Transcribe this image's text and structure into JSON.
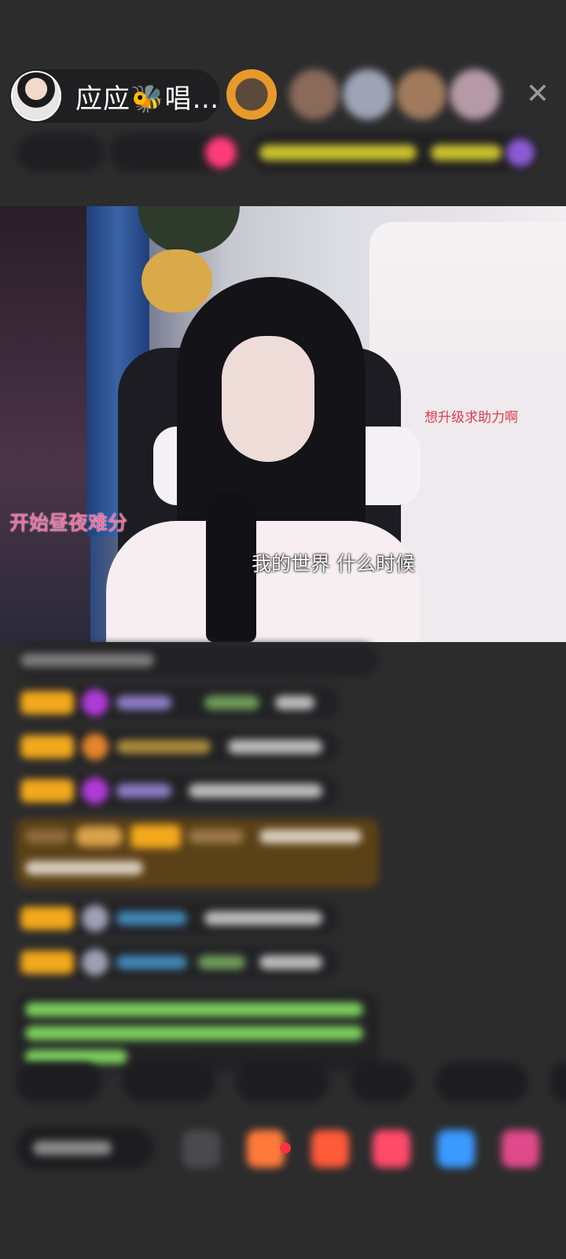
{
  "header": {
    "anchor_name": "应应🐝唱…",
    "close_label": "✕"
  },
  "video": {
    "lyric_left": "开始昼夜难分",
    "lyric_right": "我的世界  什么时候",
    "wish_text": "想升级求助力啊"
  },
  "colors": {
    "badge": "#f1a81d",
    "highlight_message": "#5b4117",
    "green_text": "#7ccf5e",
    "lyric_pink": "#ff5c9a",
    "wish_red": "#e23a4a"
  }
}
